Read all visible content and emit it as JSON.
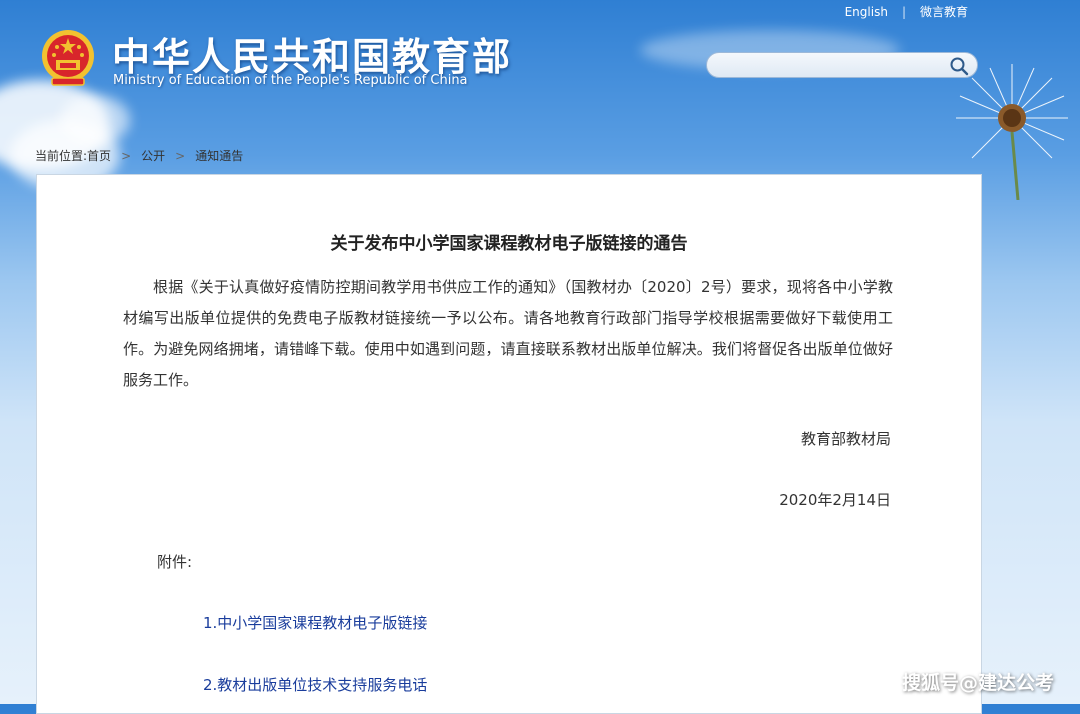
{
  "header": {
    "title": "中华人民共和国教育部",
    "subtitle": "Ministry of Education of the People's Republic of China",
    "links": [
      "English",
      "微言教育"
    ],
    "search": {
      "value": "",
      "placeholder": ""
    }
  },
  "breadcrumb": {
    "label": "当前位置:",
    "items": [
      "首页",
      "公开",
      "通知通告"
    ]
  },
  "article": {
    "title": "关于发布中小学国家课程教材电子版链接的通告",
    "body": "根据《关于认真做好疫情防控期间教学用书供应工作的通知》（国教材办〔2020〕2号）要求，现将各中小学教材编写出版单位提供的免费电子版教材链接统一予以公布。请各地教育行政部门指导学校根据需要做好下载使用工作。为避免网络拥堵，请错峰下载。使用中如遇到问题，请直接联系教材出版单位解决。我们将督促各出版单位做好服务工作。",
    "signature": "教育部教材局",
    "date": "2020年2月14日",
    "attachments_label": "附件:",
    "attachments": [
      "1.中小学国家课程教材电子版链接",
      "2.教材出版单位技术支持服务电话"
    ]
  },
  "watermark": "搜狐号@建达公考",
  "colors": {
    "link": "#1a3d9c",
    "sky_top": "#2f7fd3",
    "emblem_red": "#d8262b",
    "emblem_gold": "#f2c230"
  }
}
